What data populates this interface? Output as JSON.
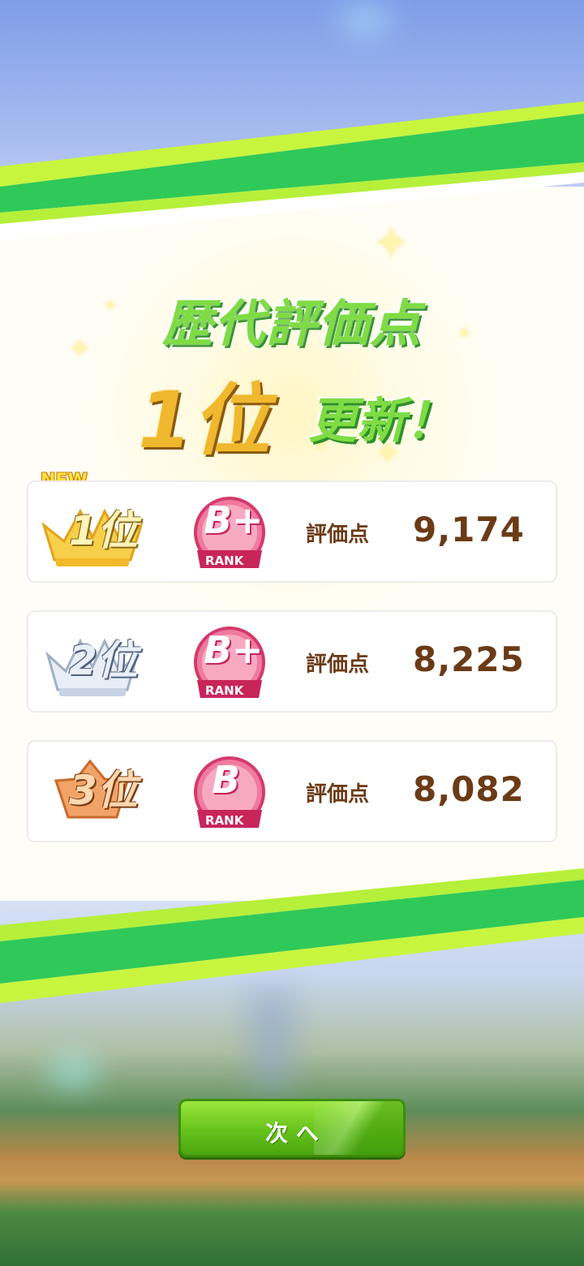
{
  "title": {
    "line1": "歴代評価点",
    "rank_text": "1位",
    "suffix": "更新！"
  },
  "colors": {
    "title_green": "#7fdc44",
    "title_gold": "#f0b82e",
    "score_brown": "#6b3b16",
    "grade_pink": "#e4457a",
    "stripe_green": "#2fc95a",
    "stripe_lime": "#b6f03a"
  },
  "rankings": [
    {
      "rank_label": "1位",
      "badge_icon": "gold-crown-icon",
      "is_new": true,
      "new_label": "NEW",
      "grade": "B+",
      "grade_sub": "RANK",
      "score_label": "評価点",
      "score": "9,174"
    },
    {
      "rank_label": "2位",
      "badge_icon": "silver-crown-icon",
      "is_new": false,
      "grade": "B+",
      "grade_sub": "RANK",
      "score_label": "評価点",
      "score": "8,225"
    },
    {
      "rank_label": "3位",
      "badge_icon": "bronze-badge-icon",
      "is_new": false,
      "grade": "B",
      "grade_sub": "RANK",
      "score_label": "評価点",
      "score": "8,082"
    }
  ],
  "next_button": {
    "label": "次 へ"
  }
}
